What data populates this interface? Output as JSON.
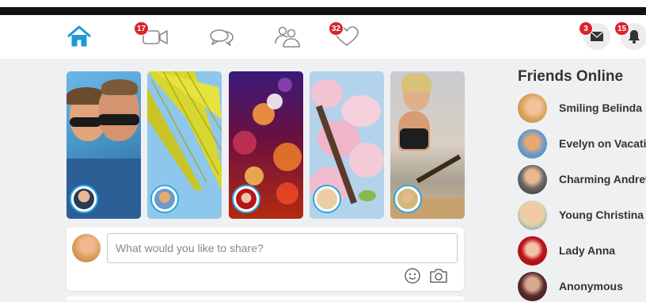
{
  "nav": {
    "icons": [
      {
        "name": "home-icon",
        "color": "#1b9ad6"
      },
      {
        "name": "video-icon",
        "badge": "17"
      },
      {
        "name": "chat-icon"
      },
      {
        "name": "people-icon"
      },
      {
        "name": "heart-icon",
        "badge": "32"
      }
    ],
    "right": [
      {
        "name": "mail-icon",
        "badge": "3"
      },
      {
        "name": "bell-icon",
        "badge": "15"
      }
    ],
    "accent": "#1b9ad6",
    "badge_color": "#d9232e"
  },
  "stories": [
    {
      "name": "story-couple-selfie"
    },
    {
      "name": "story-palm-leaf"
    },
    {
      "name": "story-bokeh-lights"
    },
    {
      "name": "story-cherry-blossom"
    },
    {
      "name": "story-beach-guitar"
    }
  ],
  "composer": {
    "placeholder": "What would you like to share?",
    "tools": [
      "emoji-icon",
      "camera-icon"
    ]
  },
  "friends": {
    "title": "Friends Online",
    "items": [
      {
        "label": "Smiling Belinda"
      },
      {
        "label": "Evelyn on Vacation"
      },
      {
        "label": "Charming Andrew"
      },
      {
        "label": "Young Christina"
      },
      {
        "label": "Lady Anna"
      },
      {
        "label": "Anonymous"
      }
    ]
  }
}
